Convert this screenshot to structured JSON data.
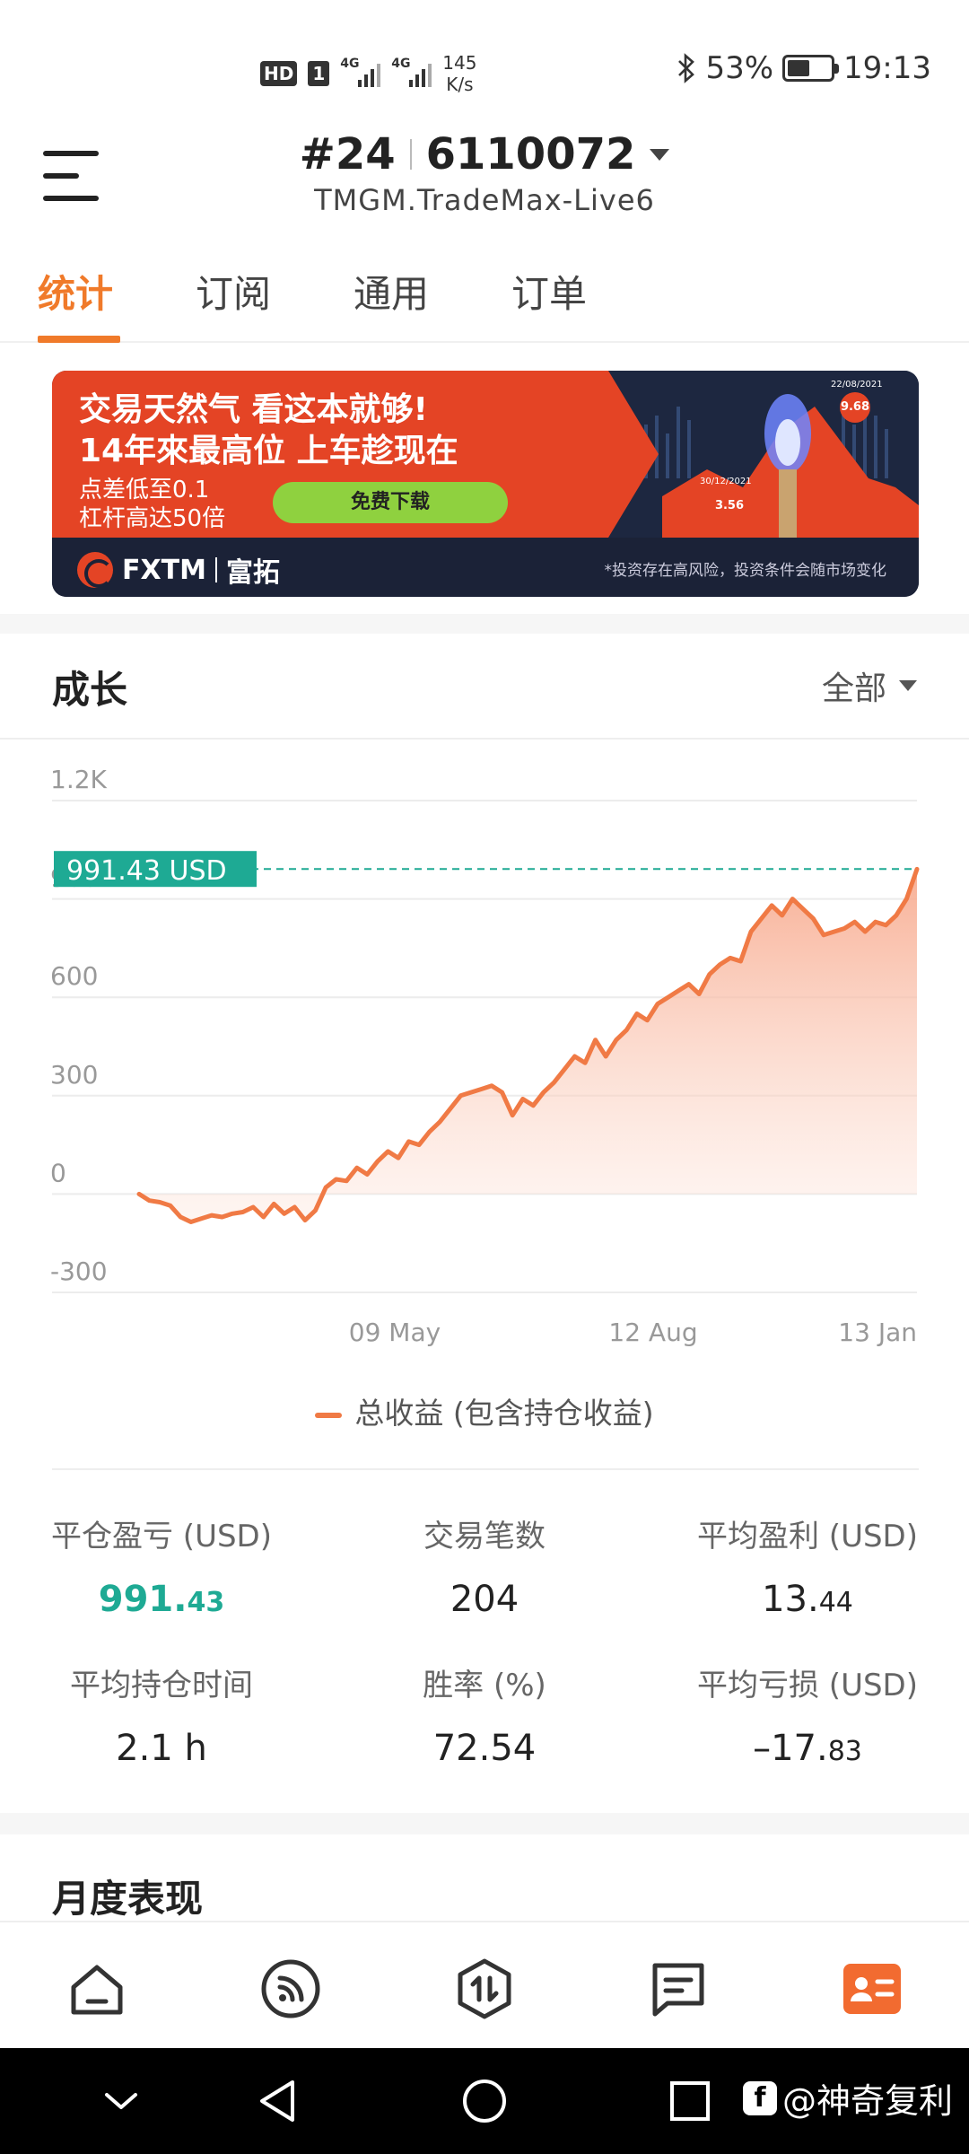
{
  "status_bar": {
    "hd": "HD",
    "sim": "1",
    "net1": "4G",
    "net2": "4G",
    "speed_value": "145",
    "speed_unit": "K/s",
    "battery_pct": "53%",
    "battery_level": 0.53,
    "time": "19:13"
  },
  "header": {
    "rank": "#24",
    "account": "6110072",
    "server": "TMGM.TradeMax-Live6"
  },
  "tabs": [
    {
      "label": "统计",
      "active": true
    },
    {
      "label": "订阅",
      "active": false
    },
    {
      "label": "通用",
      "active": false
    },
    {
      "label": "订单",
      "active": false
    }
  ],
  "banner": {
    "headline1": "交易天然气 看这本就够!",
    "headline2": "14年來最高位 上车趁现在",
    "sub1": "点差低至0.1",
    "sub2": "杠杆高达50倍",
    "cta": "免费下载",
    "brand": "FXTM",
    "brand_cn": "富拓",
    "disclaimer": "*投资存在高风险，投资条件会随市场变化",
    "date_left": "30/12/2021",
    "date_right": "22/08/2021",
    "value_low": "3.56",
    "value_high": "9.68"
  },
  "growth": {
    "title": "成长",
    "range": "全部"
  },
  "chart_data": {
    "type": "area",
    "y_ticks": [
      "1.2K",
      "900",
      "600",
      "300",
      "0",
      "-300"
    ],
    "y_tick_values": [
      1200,
      900,
      600,
      300,
      0,
      -300
    ],
    "ylim": [
      -300,
      1200
    ],
    "x_tick_labels": [
      "09 May",
      "12 Aug",
      "13 Jan"
    ],
    "current_value_label": "991.43 USD",
    "current_value": 991.43,
    "series": [
      {
        "name": "总收益 (包含持仓收益)",
        "color": "#f07a45",
        "values": [
          0,
          -20,
          -25,
          -35,
          -70,
          -85,
          -75,
          -65,
          -70,
          -60,
          -55,
          -40,
          -70,
          -30,
          -60,
          -40,
          -80,
          -50,
          20,
          45,
          40,
          80,
          60,
          100,
          130,
          110,
          160,
          150,
          190,
          220,
          260,
          300,
          310,
          320,
          330,
          310,
          240,
          290,
          270,
          310,
          340,
          380,
          420,
          400,
          470,
          420,
          470,
          500,
          550,
          530,
          580,
          600,
          620,
          640,
          610,
          670,
          700,
          720,
          710,
          800,
          840,
          880,
          850,
          900,
          870,
          840,
          790,
          800,
          810,
          830,
          800,
          830,
          820,
          850,
          900,
          991
        ]
      }
    ],
    "grid": true
  },
  "legend": {
    "label": "总收益 (包含持仓收益)"
  },
  "stats": [
    {
      "label": "平仓盈亏 (USD)",
      "main": "991.",
      "decimal": "43",
      "green": true
    },
    {
      "label": "交易笔数",
      "main": "204",
      "decimal": "",
      "green": false
    },
    {
      "label": "平均盈利 (USD)",
      "main": "13.",
      "decimal": "44",
      "green": false
    },
    {
      "label": "平均持仓时间",
      "main": "2.1 h",
      "decimal": "",
      "green": false
    },
    {
      "label": "胜率 (%)",
      "main": "72.54",
      "decimal": "",
      "green": false
    },
    {
      "label": "平均亏损 (USD)",
      "main": "–17.",
      "decimal": "83",
      "green": false
    }
  ],
  "monthly": {
    "title": "月度表现"
  },
  "bottom_nav": [
    {
      "icon": "home-icon",
      "active": false
    },
    {
      "icon": "feed-icon",
      "active": false
    },
    {
      "icon": "trade-icon",
      "active": false
    },
    {
      "icon": "message-icon",
      "active": false
    },
    {
      "icon": "profile-card-icon",
      "active": true
    }
  ],
  "watermark": {
    "text": "@神奇复利"
  },
  "colors": {
    "accent": "#f07a2a",
    "line": "#f07a45",
    "green": "#1eaa94"
  }
}
